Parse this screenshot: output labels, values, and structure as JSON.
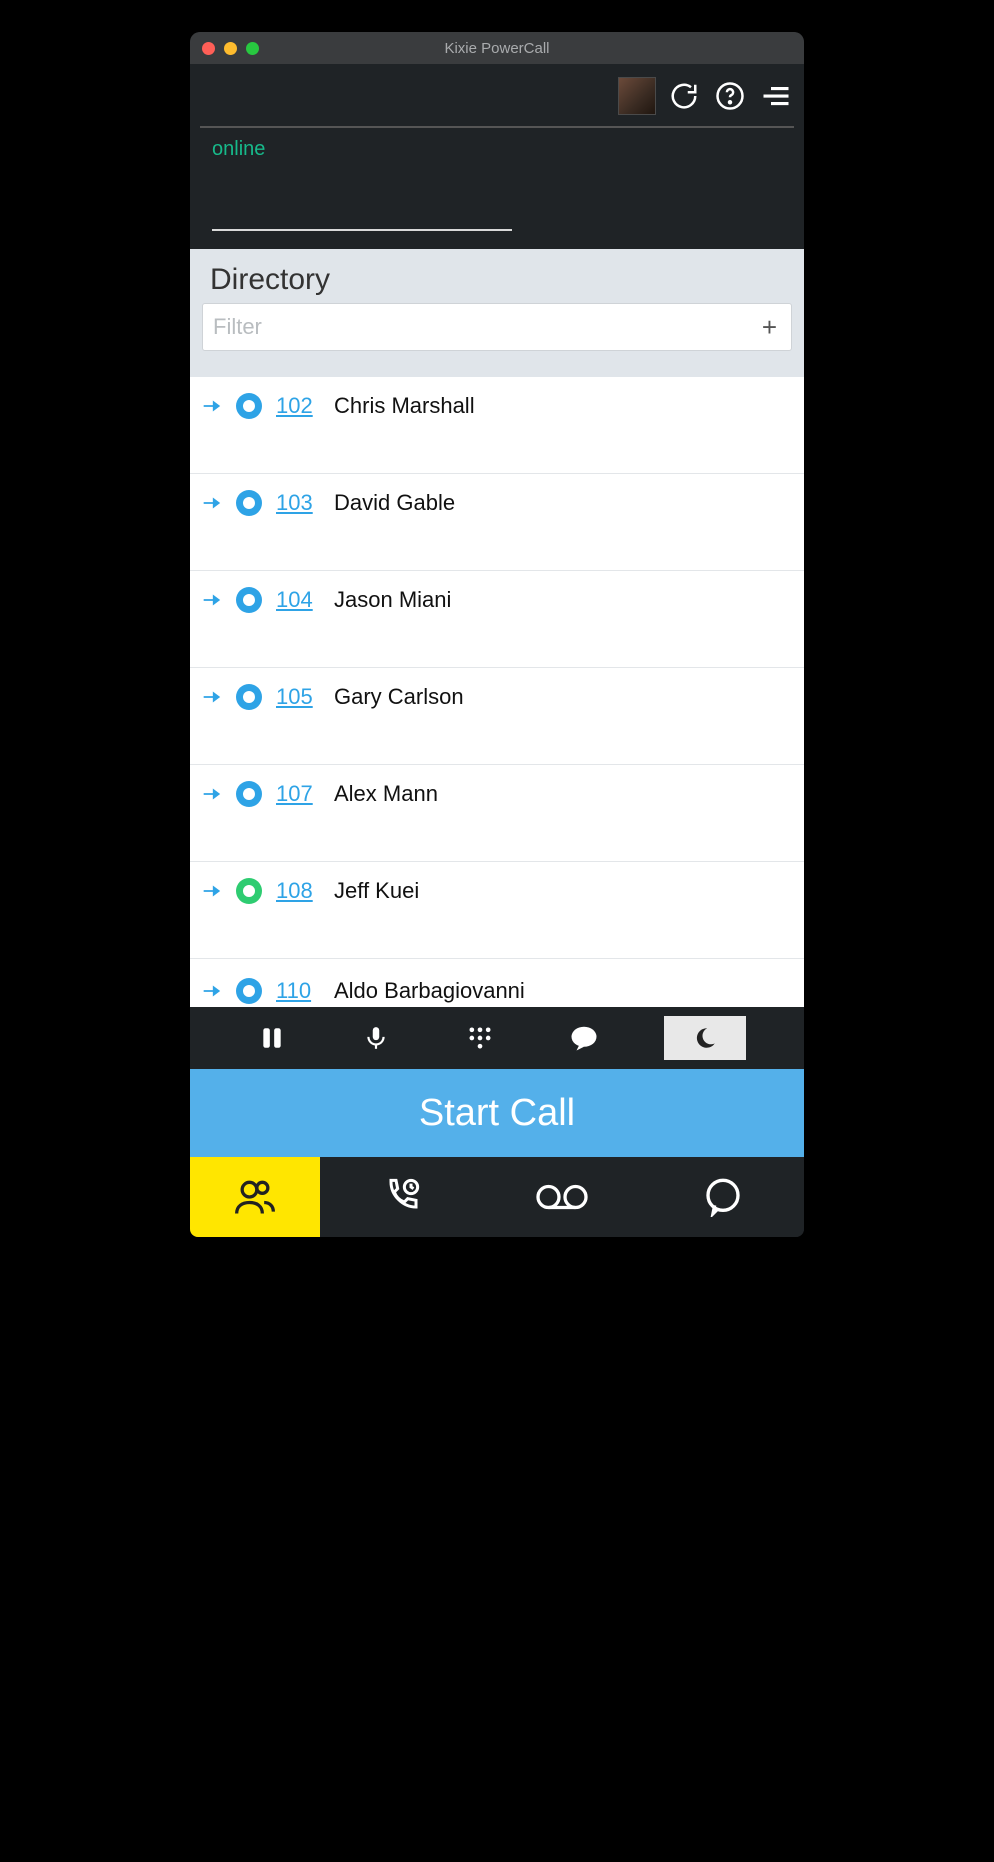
{
  "window": {
    "title": "Kixie PowerCall"
  },
  "status": {
    "text": "online"
  },
  "directory": {
    "title": "Directory",
    "filter_placeholder": "Filter",
    "contacts": [
      {
        "ext": "102",
        "name": "Chris Marshall",
        "presence": "blue"
      },
      {
        "ext": "103",
        "name": "David Gable",
        "presence": "blue"
      },
      {
        "ext": "104",
        "name": "Jason Miani",
        "presence": "blue"
      },
      {
        "ext": "105",
        "name": "Gary Carlson",
        "presence": "blue"
      },
      {
        "ext": "107",
        "name": "Alex Mann",
        "presence": "blue"
      },
      {
        "ext": "108",
        "name": "Jeff Kuei",
        "presence": "green"
      },
      {
        "ext": "110",
        "name": "Aldo Barbagiovanni",
        "presence": "blue"
      }
    ]
  },
  "call_button": {
    "label": "Start Call"
  }
}
